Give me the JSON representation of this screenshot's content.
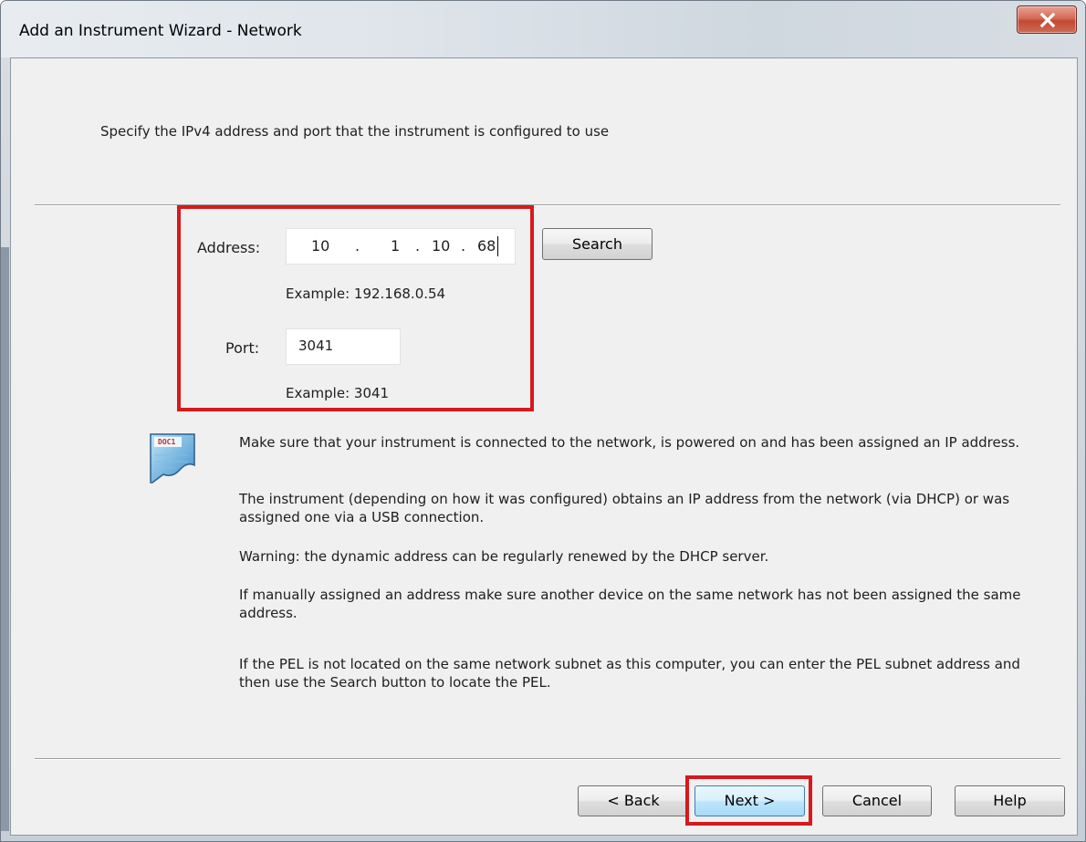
{
  "window": {
    "title": "Add an Instrument Wizard - Network",
    "close_icon": "close-x-icon"
  },
  "page": {
    "description": "Specify the IPv4 address and port that the instrument is configured to use"
  },
  "address": {
    "label": "Address:",
    "octets": [
      "10",
      "1",
      "10",
      "68"
    ],
    "dot": ".",
    "example": "Example: 192.168.0.54",
    "search_label": "Search"
  },
  "port": {
    "label": "Port:",
    "value": "3041",
    "example": "Example: 3041"
  },
  "info": {
    "icon": "document-note-icon",
    "icon_text": "DOC1",
    "paragraphs": [
      "Make sure that your instrument is connected to the network, is powered on and has been assigned an IP address.",
      "The instrument (depending on how it was configured) obtains an IP address from the network (via DHCP) or was assigned one via a USB connection.",
      "Warning: the dynamic address can be regularly renewed by the DHCP server.",
      "If manually assigned an address make sure another device on the same network has not been assigned the same address.",
      "If the PEL is not located on the same network subnet as this computer, you can enter the PEL subnet address and then use the Search button to locate the PEL."
    ]
  },
  "footer": {
    "back": "< Back",
    "next": "Next >",
    "cancel": "Cancel",
    "help": "Help"
  },
  "colors": {
    "highlight": "#d7191c",
    "dialog_bg": "#f0f0f0",
    "primary_button": "#bee6fd"
  }
}
